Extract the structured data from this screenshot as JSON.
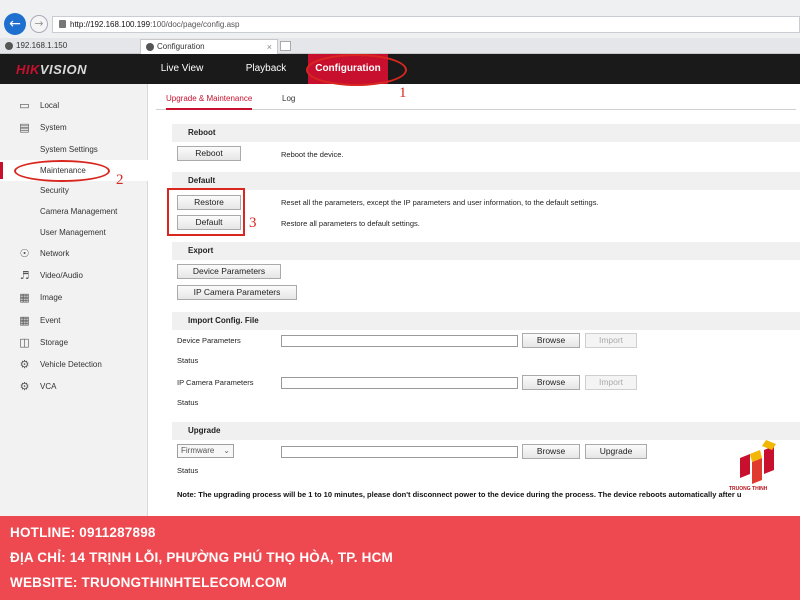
{
  "browser": {
    "address_host": "http://192.168.100.199",
    "address_path": ":100/doc/page/config.asp",
    "tabs": [
      {
        "label": "192.168.1.150"
      },
      {
        "label": "Configuration"
      }
    ],
    "back_icon": "back-arrow-icon",
    "forward_icon": "forward-arrow-icon"
  },
  "header": {
    "logo_red": "HIK",
    "logo_rest": "VISION",
    "nav": [
      {
        "label": "Live View"
      },
      {
        "label": "Playback"
      },
      {
        "label": "Configuration",
        "active": true
      }
    ]
  },
  "sidebar": {
    "items": [
      {
        "label": "Local",
        "icon": "monitor-icon"
      },
      {
        "label": "System",
        "icon": "system-icon"
      },
      {
        "label": "System Settings"
      },
      {
        "label": "Maintenance",
        "active": true
      },
      {
        "label": "Security"
      },
      {
        "label": "Camera Management"
      },
      {
        "label": "User Management"
      },
      {
        "label": "Network",
        "icon": "globe-icon"
      },
      {
        "label": "Video/Audio",
        "icon": "video-audio-icon"
      },
      {
        "label": "Image",
        "icon": "image-icon"
      },
      {
        "label": "Event",
        "icon": "calendar-icon"
      },
      {
        "label": "Storage",
        "icon": "storage-icon"
      },
      {
        "label": "Vehicle Detection",
        "icon": "vehicle-detection-icon"
      },
      {
        "label": "VCA",
        "icon": "vca-icon"
      }
    ]
  },
  "content": {
    "subtabs": [
      {
        "label": "Upgrade & Maintenance",
        "active": true
      },
      {
        "label": "Log"
      }
    ],
    "reboot": {
      "heading": "Reboot",
      "button": "Reboot",
      "description": "Reboot the device."
    },
    "default": {
      "heading": "Default",
      "restore_button": "Restore",
      "restore_description": "Reset all the parameters, except the IP parameters and user information, to the default settings.",
      "default_button": "Default",
      "default_description": "Restore all parameters to default settings."
    },
    "export": {
      "heading": "Export",
      "device_params_button": "Device Parameters",
      "ip_camera_params_button": "IP Camera Parameters"
    },
    "import": {
      "heading": "Import Config. File",
      "device_params_label": "Device Parameters",
      "ip_camera_params_label": "IP Camera Parameters",
      "status_label": "Status",
      "browse_button": "Browse",
      "import_button": "Import"
    },
    "upgrade": {
      "heading": "Upgrade",
      "select_value": "Firmware",
      "browse_button": "Browse",
      "upgrade_button": "Upgrade",
      "status_label": "Status"
    },
    "note": "Note: The upgrading process will be 1 to 10 minutes, please don't disconnect power to the device during the process. The device reboots automatically after u"
  },
  "annotations": {
    "step1": "1",
    "step2": "2",
    "step3": "3",
    "color": "#d9271f"
  },
  "watermark": {
    "text": "TRUONG THINH"
  },
  "footer": {
    "hotline": "HOTLINE: 0911287898",
    "address": "ĐỊA CHỈ: 14 TRỊNH LỖI, PHƯỜNG PHÚ THỌ HÒA, TP. HCM",
    "website": "WEBSITE: TRUONGTHINHTELECOM.COM",
    "background_color": "#ee4950"
  },
  "colors": {
    "accent": "#c8102e",
    "header_bg": "#1a1a1a"
  }
}
